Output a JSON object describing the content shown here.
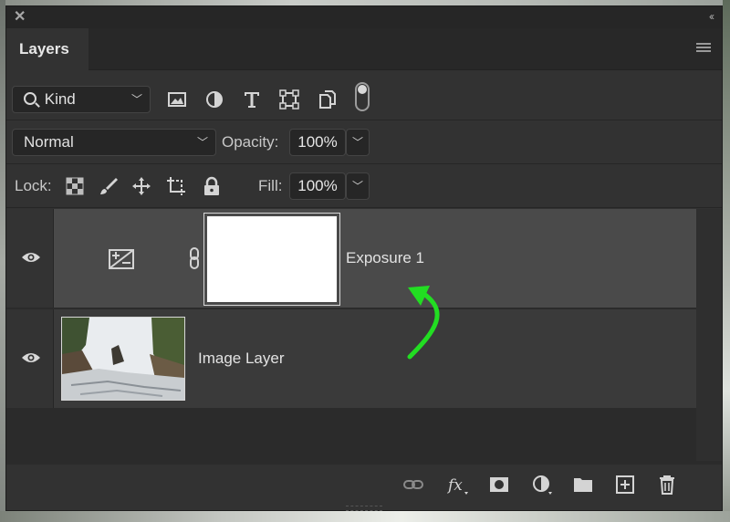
{
  "panel": {
    "tab_label": "Layers"
  },
  "filter": {
    "kind_label": "Kind"
  },
  "blend": {
    "mode": "Normal",
    "opacity_label": "Opacity:",
    "opacity_value": "100%"
  },
  "lock": {
    "lock_label": "Lock:",
    "fill_label": "Fill:",
    "fill_value": "100%"
  },
  "layers": [
    {
      "name": "Exposure 1",
      "visible": true,
      "selected": true,
      "type": "adjustment"
    },
    {
      "name": "Image Layer",
      "visible": true,
      "selected": false,
      "type": "pixel"
    }
  ],
  "colors": {
    "panel_bg": "#323232",
    "selected_row": "#4a4a4a",
    "annotation_arrow": "#22dd22"
  }
}
